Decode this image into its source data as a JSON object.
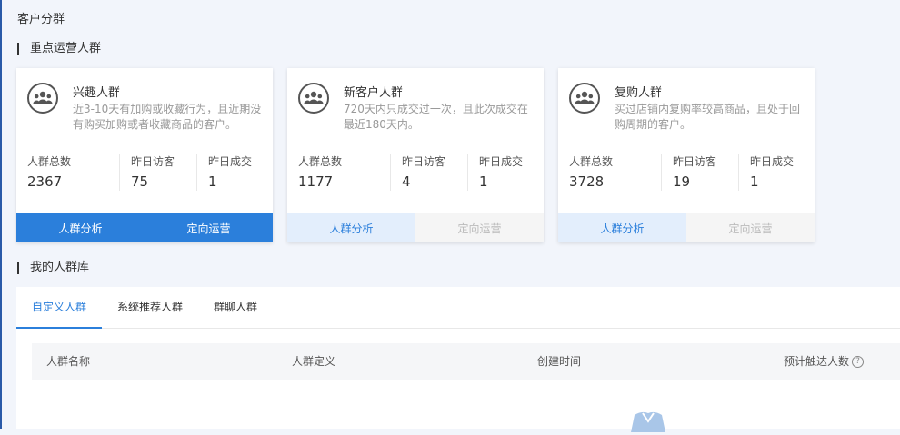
{
  "page_title": "客户分群",
  "focus_section_title": "重点运营人群",
  "library_section_title": "我的人群库",
  "cards": [
    {
      "name": "兴趣人群",
      "desc": "近3-10天有加购或收藏行为，且近期没有购买加购或者收藏商品的客户。",
      "stats": [
        {
          "label": "人群总数",
          "value": "2367"
        },
        {
          "label": "昨日访客",
          "value": "75"
        },
        {
          "label": "昨日成交",
          "value": "1"
        }
      ],
      "analysis_label": "人群分析",
      "operate_label": "定向运营"
    },
    {
      "name": "新客户人群",
      "desc": "720天内只成交过一次，且此次成交在最近180天内。",
      "stats": [
        {
          "label": "人群总数",
          "value": "1177"
        },
        {
          "label": "昨日访客",
          "value": "4"
        },
        {
          "label": "昨日成交",
          "value": "1"
        }
      ],
      "analysis_label": "人群分析",
      "operate_label": "定向运营"
    },
    {
      "name": "复购人群",
      "desc": "买过店铺内复购率较高商品，且处于回购周期的客户。",
      "stats": [
        {
          "label": "人群总数",
          "value": "3728"
        },
        {
          "label": "昨日访客",
          "value": "19"
        },
        {
          "label": "昨日成交",
          "value": "1"
        }
      ],
      "analysis_label": "人群分析",
      "operate_label": "定向运营"
    }
  ],
  "tabs": [
    "自定义人群",
    "系统推荐人群",
    "群聊人群"
  ],
  "table_headers": {
    "name": "人群名称",
    "definition": "人群定义",
    "created": "创建时间",
    "reach": "预计触达人数"
  },
  "icons": {
    "group": "group-users-icon",
    "help": "question-icon"
  },
  "colors": {
    "primary": "#2b7fdb",
    "soft": "#e3eefc",
    "disabled_text": "#bbbbbb"
  }
}
